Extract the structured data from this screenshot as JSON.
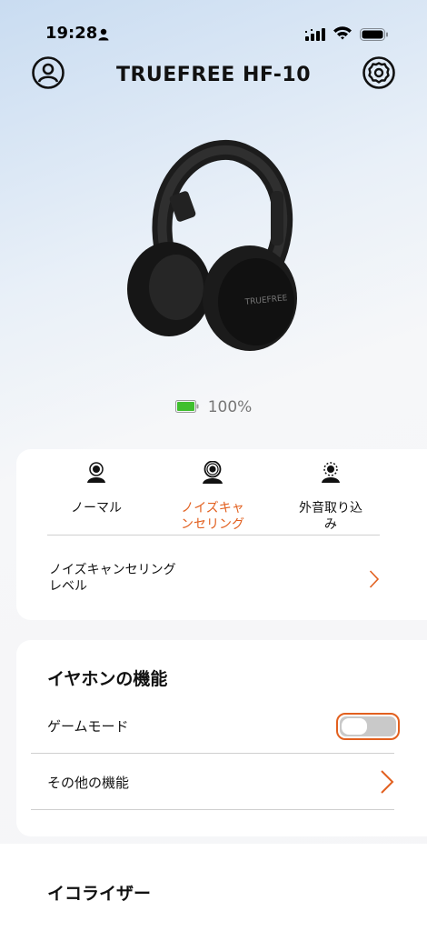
{
  "status_bar": {
    "time": "19:28"
  },
  "header": {
    "title": "TRUEFREE HF-10",
    "profile_icon": "person-circle-icon",
    "settings_icon": "gear-icon"
  },
  "device": {
    "image": "headphones-image",
    "battery_percent": "100%",
    "battery_level": 1.0,
    "battery_color": "#3fbf2e"
  },
  "modes": {
    "items": [
      {
        "label": "ノーマル",
        "icon": "person-normal-icon"
      },
      {
        "label": "ノイズキャンセリング",
        "label_lines": [
          "ノイズキャ",
          "ンセリング"
        ],
        "icon": "person-anc-icon"
      },
      {
        "label": "外音取り込み",
        "label_lines": [
          "外音取り込",
          "み"
        ],
        "icon": "person-ambient-icon"
      }
    ],
    "selected": "ノイズキャンセリング",
    "accent_color": "#e2601f"
  },
  "noise_level": {
    "label_lines": [
      "ノイズキャンセリング",
      "レベル"
    ]
  },
  "earphone_features": {
    "title": "イヤホンの機能",
    "game_mode_label": "ゲームモード",
    "game_mode_on": false,
    "other_label": "その他の機能"
  },
  "equalizer": {
    "title": "イコライザー"
  }
}
